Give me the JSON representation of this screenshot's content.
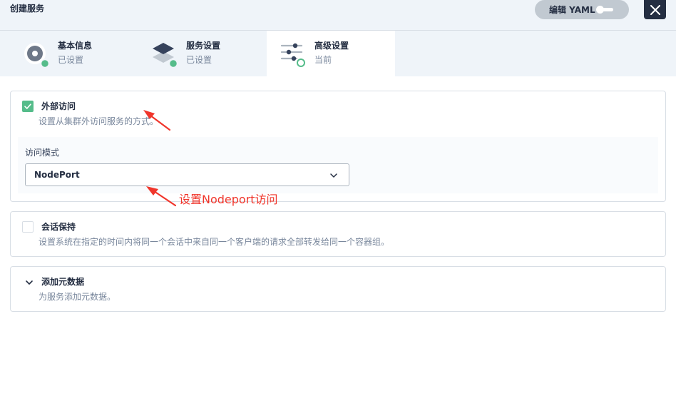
{
  "header": {
    "title": "创建服务",
    "yaml_label": "编辑 YAML"
  },
  "steps": [
    {
      "name": "基本信息",
      "status": "已设置"
    },
    {
      "name": "服务设置",
      "status": "已设置"
    },
    {
      "name": "高级设置",
      "status": "当前"
    }
  ],
  "external_access": {
    "checked": true,
    "title": "外部访问",
    "description": "设置从集群外访问服务的方式。",
    "mode_label": "访问模式",
    "mode_value": "NodePort"
  },
  "session_affinity": {
    "checked": false,
    "title": "会话保持",
    "description": "设置系统在指定的时间内将同一个会话中来自同一个客户端的请求全部转发给同一个容器组。"
  },
  "metadata": {
    "title": "添加元数据",
    "description": "为服务添加元数据。"
  },
  "annotation": {
    "text": "设置Nodeport访问"
  },
  "colors": {
    "accent": "#55bc8a",
    "dark": "#242e42",
    "muted": "#79879c",
    "annotation": "#f0352b"
  }
}
